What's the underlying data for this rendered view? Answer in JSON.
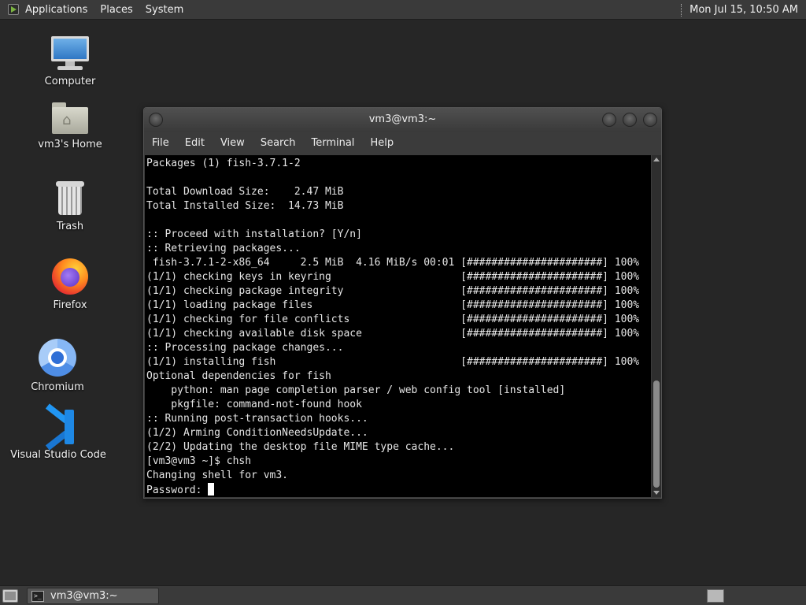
{
  "top_panel": {
    "menus": [
      "Applications",
      "Places",
      "System"
    ],
    "clock": "Mon Jul 15, 10:50 AM"
  },
  "desktop": {
    "icons": [
      {
        "label": "Computer",
        "icon": "computer-icon"
      },
      {
        "label": "vm3's Home",
        "icon": "home-folder-icon"
      },
      {
        "label": "Trash",
        "icon": "trash-icon"
      },
      {
        "label": "Firefox",
        "icon": "firefox-icon"
      },
      {
        "label": "Chromium",
        "icon": "chromium-icon"
      },
      {
        "label": "Visual Studio Code",
        "icon": "vscode-icon"
      }
    ]
  },
  "terminal": {
    "title": "vm3@vm3:~",
    "menus": [
      "File",
      "Edit",
      "View",
      "Search",
      "Terminal",
      "Help"
    ],
    "lines": [
      "Packages (1) fish-3.7.1-2",
      "",
      "Total Download Size:    2.47 MiB",
      "Total Installed Size:  14.73 MiB",
      "",
      ":: Proceed with installation? [Y/n]",
      ":: Retrieving packages...",
      " fish-3.7.1-2-x86_64     2.5 MiB  4.16 MiB/s 00:01 [######################] 100%",
      "(1/1) checking keys in keyring                     [######################] 100%",
      "(1/1) checking package integrity                   [######################] 100%",
      "(1/1) loading package files                        [######################] 100%",
      "(1/1) checking for file conflicts                  [######################] 100%",
      "(1/1) checking available disk space                [######################] 100%",
      ":: Processing package changes...",
      "(1/1) installing fish                              [######################] 100%",
      "Optional dependencies for fish",
      "    python: man page completion parser / web config tool [installed]",
      "    pkgfile: command-not-found hook",
      ":: Running post-transaction hooks...",
      "(1/2) Arming ConditionNeedsUpdate...",
      "(2/2) Updating the desktop file MIME type cache...",
      "[vm3@vm3 ~]$ chsh",
      "Changing shell for vm3."
    ],
    "prompt_line": "Password: "
  },
  "bottom_panel": {
    "task_label": "vm3@vm3:~"
  }
}
